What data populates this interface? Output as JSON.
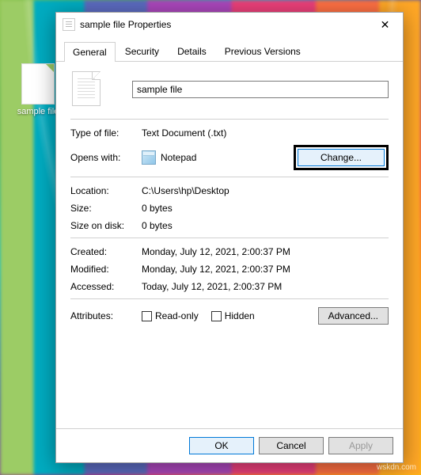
{
  "desktop": {
    "icon_label": "sample file"
  },
  "window": {
    "title": "sample file Properties"
  },
  "tabs": {
    "general": "General",
    "security": "Security",
    "details": "Details",
    "previous": "Previous Versions"
  },
  "fields": {
    "filename": "sample file",
    "type_label": "Type of file:",
    "type_value": "Text Document (.txt)",
    "opens_label": "Opens with:",
    "opens_value": "Notepad",
    "change_btn": "Change...",
    "location_label": "Location:",
    "location_value": "C:\\Users\\hp\\Desktop",
    "size_label": "Size:",
    "size_value": "0 bytes",
    "sizeondisk_label": "Size on disk:",
    "sizeondisk_value": "0 bytes",
    "created_label": "Created:",
    "created_value": "Monday, July 12, 2021, 2:00:37 PM",
    "modified_label": "Modified:",
    "modified_value": "Monday, July 12, 2021, 2:00:37 PM",
    "accessed_label": "Accessed:",
    "accessed_value": "Today, July 12, 2021, 2:00:37 PM",
    "attributes_label": "Attributes:",
    "readonly_label": "Read-only",
    "hidden_label": "Hidden",
    "advanced_btn": "Advanced..."
  },
  "buttons": {
    "ok": "OK",
    "cancel": "Cancel",
    "apply": "Apply"
  },
  "watermark": "wskdn.com"
}
